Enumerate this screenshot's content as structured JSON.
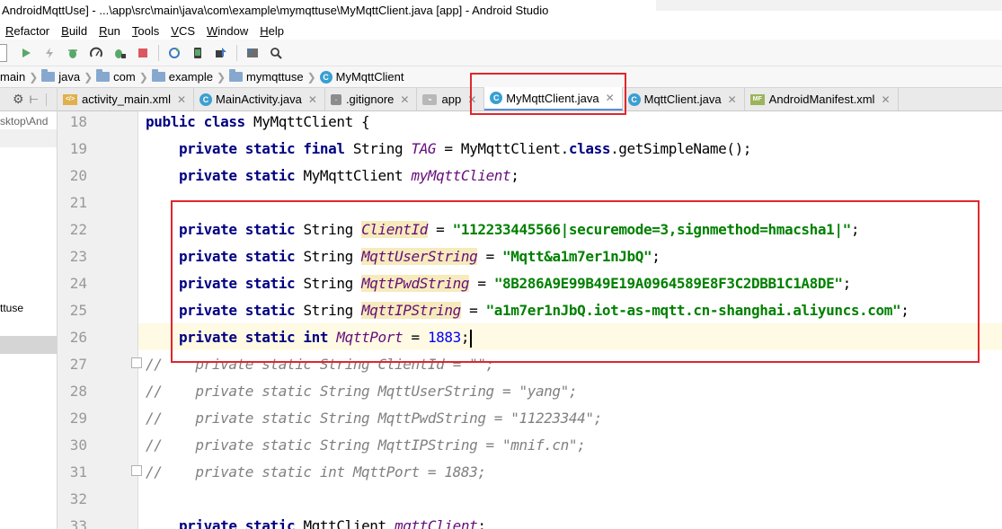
{
  "window": {
    "title": "AndroidMqttUse] - ...\\app\\src\\main\\java\\com\\example\\mymqttuse\\MyMqttClient.java [app] - Android Studio"
  },
  "menu": [
    "Refactor",
    "Build",
    "Run",
    "Tools",
    "VCS",
    "Window",
    "Help"
  ],
  "toolbar_icons": [
    "run-icon",
    "apply-changes-icon",
    "debug-icon",
    "profile-icon",
    "attach-debugger-icon",
    "stop-icon",
    "sync-project-icon",
    "avd-manager-icon",
    "sdk-manager-icon",
    "project-structure-icon",
    "search-icon"
  ],
  "breadcrumb": [
    "main",
    "java",
    "com",
    "example",
    "mymqttuse",
    "MyMqttClient"
  ],
  "tabs": [
    {
      "label": "activity_main.xml",
      "icon": "xml"
    },
    {
      "label": "MainActivity.java",
      "icon": "class"
    },
    {
      "label": ".gitignore",
      "icon": "gitignore"
    },
    {
      "label": "app",
      "icon": "gradle"
    },
    {
      "label": "MyMqttClient.java",
      "icon": "class",
      "active": true
    },
    {
      "label": "MqttClient.java",
      "icon": "class"
    },
    {
      "label": "AndroidManifest.xml",
      "icon": "manifest"
    }
  ],
  "left_panel": {
    "path_text": "sktop\\And",
    "item_text": "ttuse"
  },
  "code_lines": [
    {
      "n": "18",
      "t": [
        [
          "kw",
          "public class "
        ],
        [
          "",
          "MyMqttClient {"
        ]
      ]
    },
    {
      "n": "19",
      "t": [
        [
          "",
          "    "
        ],
        [
          "kw",
          "private static final "
        ],
        [
          "",
          "String "
        ],
        [
          "fld",
          "TAG"
        ],
        [
          "",
          " = MyMqttClient."
        ],
        [
          "kw",
          "class"
        ],
        [
          "",
          ".getSimpleName();"
        ]
      ]
    },
    {
      "n": "20",
      "t": [
        [
          "",
          "    "
        ],
        [
          "kw",
          "private static "
        ],
        [
          "",
          "MyMqttClient "
        ],
        [
          "fld",
          "myMqttClient"
        ],
        [
          "",
          ";"
        ]
      ]
    },
    {
      "n": "21",
      "t": []
    },
    {
      "n": "22",
      "t": [
        [
          "",
          "    "
        ],
        [
          "kw",
          "private static "
        ],
        [
          "",
          "String "
        ],
        [
          "fld hl",
          "ClientId"
        ],
        [
          "",
          " = "
        ],
        [
          "str",
          "\"112233445566|securemode=3,signmethod=hmacsha1|\""
        ],
        [
          "",
          ";"
        ]
      ]
    },
    {
      "n": "23",
      "t": [
        [
          "",
          "    "
        ],
        [
          "kw",
          "private static "
        ],
        [
          "",
          "String "
        ],
        [
          "fld hl",
          "MqttUserString"
        ],
        [
          "",
          " = "
        ],
        [
          "str",
          "\"Mqtt&a1m7er1nJbQ\""
        ],
        [
          "",
          ";"
        ]
      ]
    },
    {
      "n": "24",
      "t": [
        [
          "",
          "    "
        ],
        [
          "kw",
          "private static "
        ],
        [
          "",
          "String "
        ],
        [
          "fld hl",
          "MqttPwdString"
        ],
        [
          "",
          " = "
        ],
        [
          "str",
          "\"8B286A9E99B49E19A0964589E8F3C2DBB1C1A8DE\""
        ],
        [
          "",
          ";"
        ]
      ]
    },
    {
      "n": "25",
      "t": [
        [
          "",
          "    "
        ],
        [
          "kw",
          "private static "
        ],
        [
          "",
          "String "
        ],
        [
          "fld hl",
          "MqttIPString"
        ],
        [
          "",
          " = "
        ],
        [
          "str",
          "\"a1m7er1nJbQ.iot-as-mqtt.cn-shanghai.aliyuncs.com\""
        ],
        [
          "",
          ";"
        ]
      ]
    },
    {
      "n": "26",
      "t": [
        [
          "",
          "    "
        ],
        [
          "kw",
          "private static int "
        ],
        [
          "fld",
          "MqttPort"
        ],
        [
          "",
          " = "
        ],
        [
          "num",
          "1883"
        ],
        [
          "",
          ";"
        ]
      ],
      "caret": true
    },
    {
      "n": "27",
      "t": [
        [
          "cm",
          "//    private static String ClientId = \"\";"
        ]
      ]
    },
    {
      "n": "28",
      "t": [
        [
          "cm",
          "//    private static String MqttUserString = \"yang\";"
        ]
      ]
    },
    {
      "n": "29",
      "t": [
        [
          "cm",
          "//    private static String MqttPwdString = \"11223344\";"
        ]
      ]
    },
    {
      "n": "30",
      "t": [
        [
          "cm",
          "//    private static String MqttIPString = \"mnif.cn\";"
        ]
      ]
    },
    {
      "n": "31",
      "t": [
        [
          "cm",
          "//    private static int MqttPort = 1883;"
        ]
      ]
    },
    {
      "n": "32",
      "t": []
    },
    {
      "n": "33",
      "t": [
        [
          "",
          "    "
        ],
        [
          "kw",
          "private static "
        ],
        [
          "",
          "MqttClient "
        ],
        [
          "fld",
          "mqttClient"
        ],
        [
          "",
          ";"
        ]
      ]
    }
  ],
  "colors": {
    "annotation_red": "#e0262d",
    "keyword": "#000080",
    "string": "#008000",
    "field": "#660e7a",
    "comment": "#808080"
  }
}
